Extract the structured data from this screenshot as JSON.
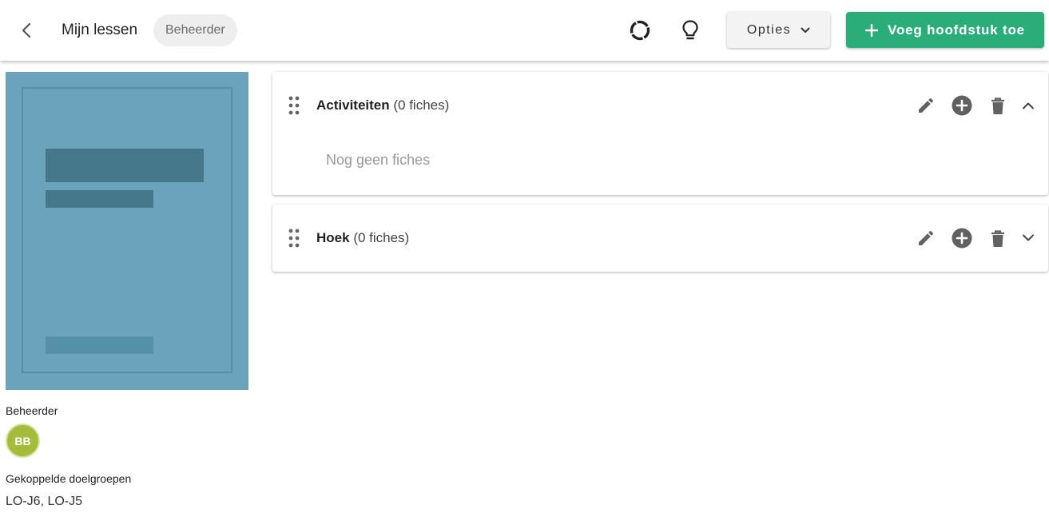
{
  "header": {
    "back_icon": "chevron-left-icon",
    "title": "Mijn lessen",
    "role_badge": "Beheerder",
    "progress_icon": "circle-dashed-icon",
    "tips_icon": "lightbulb-icon",
    "options_label": "Opties",
    "options_icon": "chevron-down-icon",
    "add_chapter_label": "Voeg hoofdstuk toe",
    "add_chapter_icon": "plus-icon"
  },
  "sidebar": {
    "cover_icon": "book-cover-placeholder",
    "owner_label": "Beheerder",
    "owner_initials": "BB",
    "groups_label": "Gekoppelde doelgroepen",
    "groups_value": "LO-J6, LO-J5"
  },
  "chapters": [
    {
      "name": "Activiteiten",
      "count": "(0 fiches)",
      "expanded": true,
      "empty_text": "Nog geen fiches"
    },
    {
      "name": "Hoek",
      "count": "(0 fiches)",
      "expanded": false
    }
  ],
  "colors": {
    "primary": "#2bad7a",
    "cover": "#6aa3bb",
    "cover_dark": "#45788b",
    "avatar": "#a5bb3a",
    "icon": "#616161"
  }
}
